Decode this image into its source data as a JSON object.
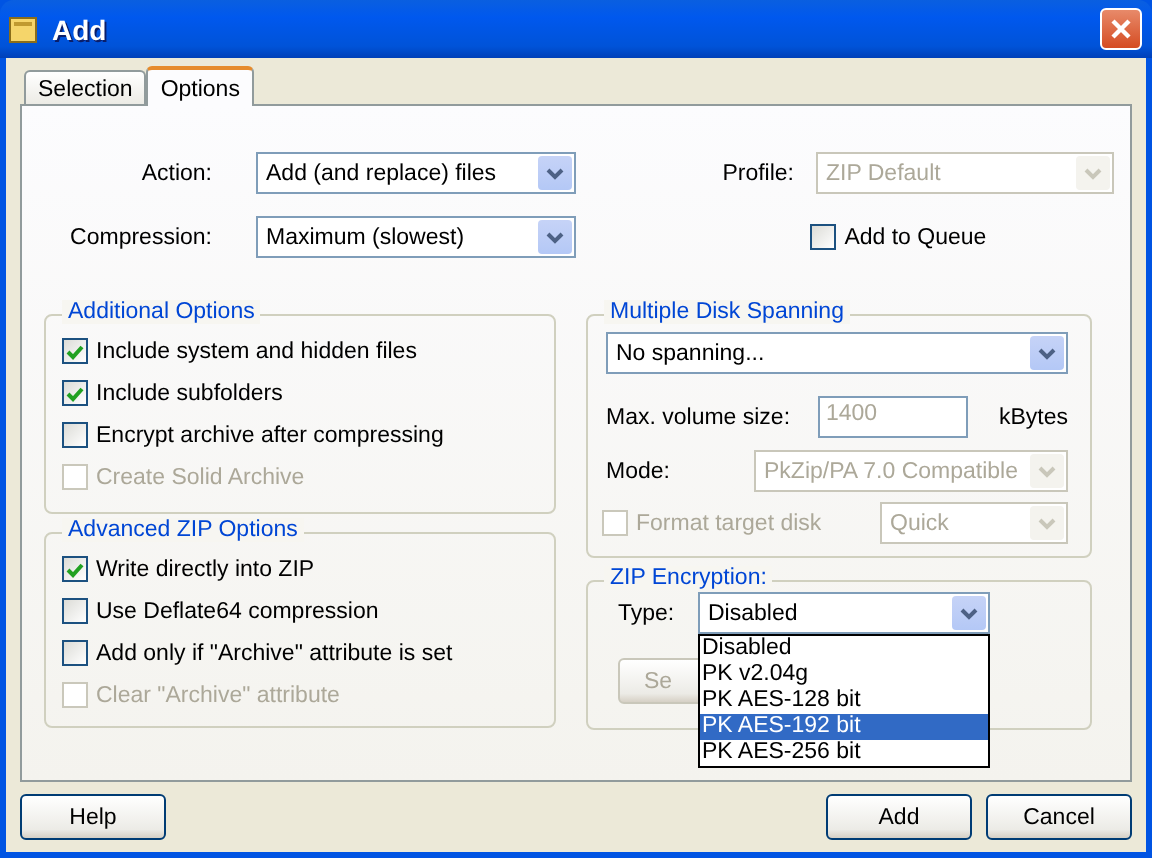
{
  "window": {
    "title": "Add"
  },
  "tabs": [
    {
      "label": "Selection",
      "selected": false
    },
    {
      "label": "Options",
      "selected": true
    }
  ],
  "action": {
    "label": "Action:",
    "value": "Add (and replace) files",
    "disabled": false
  },
  "compression": {
    "label": "Compression:",
    "value": "Maximum (slowest)",
    "disabled": false
  },
  "profile": {
    "label": "Profile:",
    "value": "ZIP Default",
    "disabled": true
  },
  "add_to_queue": {
    "label": "Add to Queue",
    "checked": false,
    "disabled": false
  },
  "additional_options": {
    "title": "Additional Options",
    "items": [
      {
        "label": "Include system and hidden files",
        "checked": true,
        "disabled": false
      },
      {
        "label": "Include subfolders",
        "checked": true,
        "disabled": false
      },
      {
        "label": "Encrypt archive after compressing",
        "checked": false,
        "disabled": false
      },
      {
        "label": "Create Solid Archive",
        "checked": false,
        "disabled": true
      }
    ]
  },
  "advanced_zip_options": {
    "title": "Advanced ZIP Options",
    "items": [
      {
        "label": "Write directly into ZIP",
        "checked": true,
        "disabled": false
      },
      {
        "label": "Use Deflate64 compression",
        "checked": false,
        "disabled": false
      },
      {
        "label": "Add only if \"Archive\" attribute is set",
        "checked": false,
        "disabled": false
      },
      {
        "label": "Clear \"Archive\" attribute",
        "checked": false,
        "disabled": true
      }
    ]
  },
  "disk_spanning": {
    "title": "Multiple Disk Spanning",
    "spanning": {
      "value": "No spanning...",
      "disabled": false
    },
    "max_volume": {
      "label": "Max. volume size:",
      "value": "1400",
      "unit": "kBytes",
      "disabled": true
    },
    "mode": {
      "label": "Mode:",
      "value": "PkZip/PA 7.0 Compatible",
      "disabled": true
    },
    "format_disk": {
      "label": "Format target disk",
      "checked": false,
      "disabled": true
    },
    "format_mode": {
      "value": "Quick",
      "disabled": true
    }
  },
  "zip_encryption": {
    "title": "ZIP Encryption:",
    "type": {
      "label": "Type:",
      "value": "Disabled",
      "disabled": false
    },
    "settings_button": {
      "label": "Se"
    },
    "dropdown": [
      {
        "label": "Disabled",
        "selected": false
      },
      {
        "label": "PK v2.04g",
        "selected": false
      },
      {
        "label": "PK AES-128 bit",
        "selected": false
      },
      {
        "label": "PK AES-192 bit",
        "selected": true
      },
      {
        "label": "PK AES-256 bit",
        "selected": false
      }
    ]
  },
  "buttons": [
    {
      "label": "Help"
    },
    {
      "label": "Add"
    },
    {
      "label": "Cancel"
    }
  ]
}
